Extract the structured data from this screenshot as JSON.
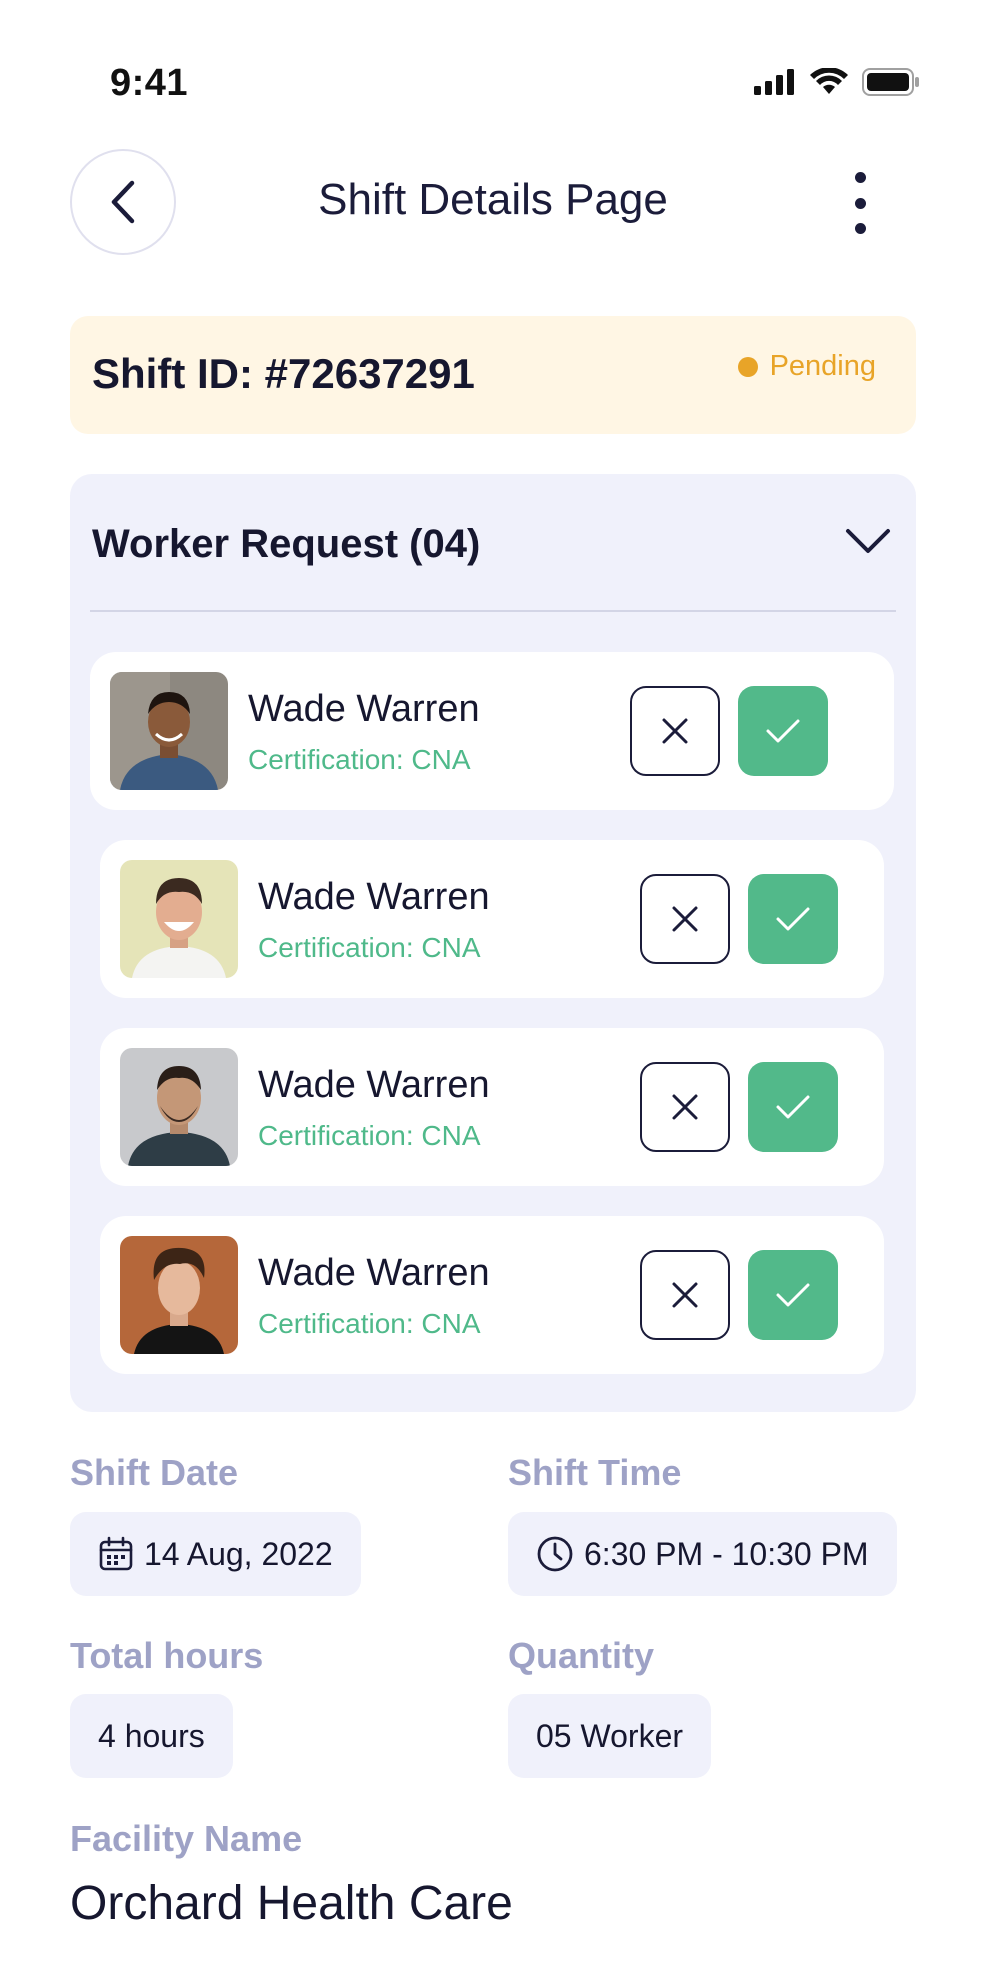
{
  "status_bar": {
    "time": "9:41"
  },
  "header": {
    "title": "Shift Details Page"
  },
  "shift": {
    "id_text": "Shift ID: #72637291",
    "status": "Pending",
    "status_color": "#e8a428"
  },
  "worker_request": {
    "title": "Worker Request (04)",
    "workers": [
      {
        "name": "Wade Warren",
        "certification": "Certification: CNA"
      },
      {
        "name": "Wade Warren",
        "certification": "Certification: CNA"
      },
      {
        "name": "Wade Warren",
        "certification": "Certification: CNA"
      },
      {
        "name": "Wade Warren",
        "certification": "Certification: CNA"
      }
    ]
  },
  "details": {
    "shift_date": {
      "label": "Shift Date",
      "value": "14 Aug, 2022",
      "icon": "calendar-icon"
    },
    "shift_time": {
      "label": "Shift Time",
      "value": "6:30 PM - 10:30 PM",
      "icon": "clock-icon"
    },
    "total_hours": {
      "label": "Total hours",
      "value": "4 hours"
    },
    "quantity": {
      "label": "Quantity",
      "value": "05 Worker"
    },
    "facility": {
      "label": "Facility Name",
      "value": "Orchard Health Care"
    }
  },
  "colors": {
    "accent_green": "#52b98a",
    "label_muted": "#9ea2c6",
    "panel_bg": "#f0f1fb",
    "pending_bg": "#fff6e4"
  }
}
